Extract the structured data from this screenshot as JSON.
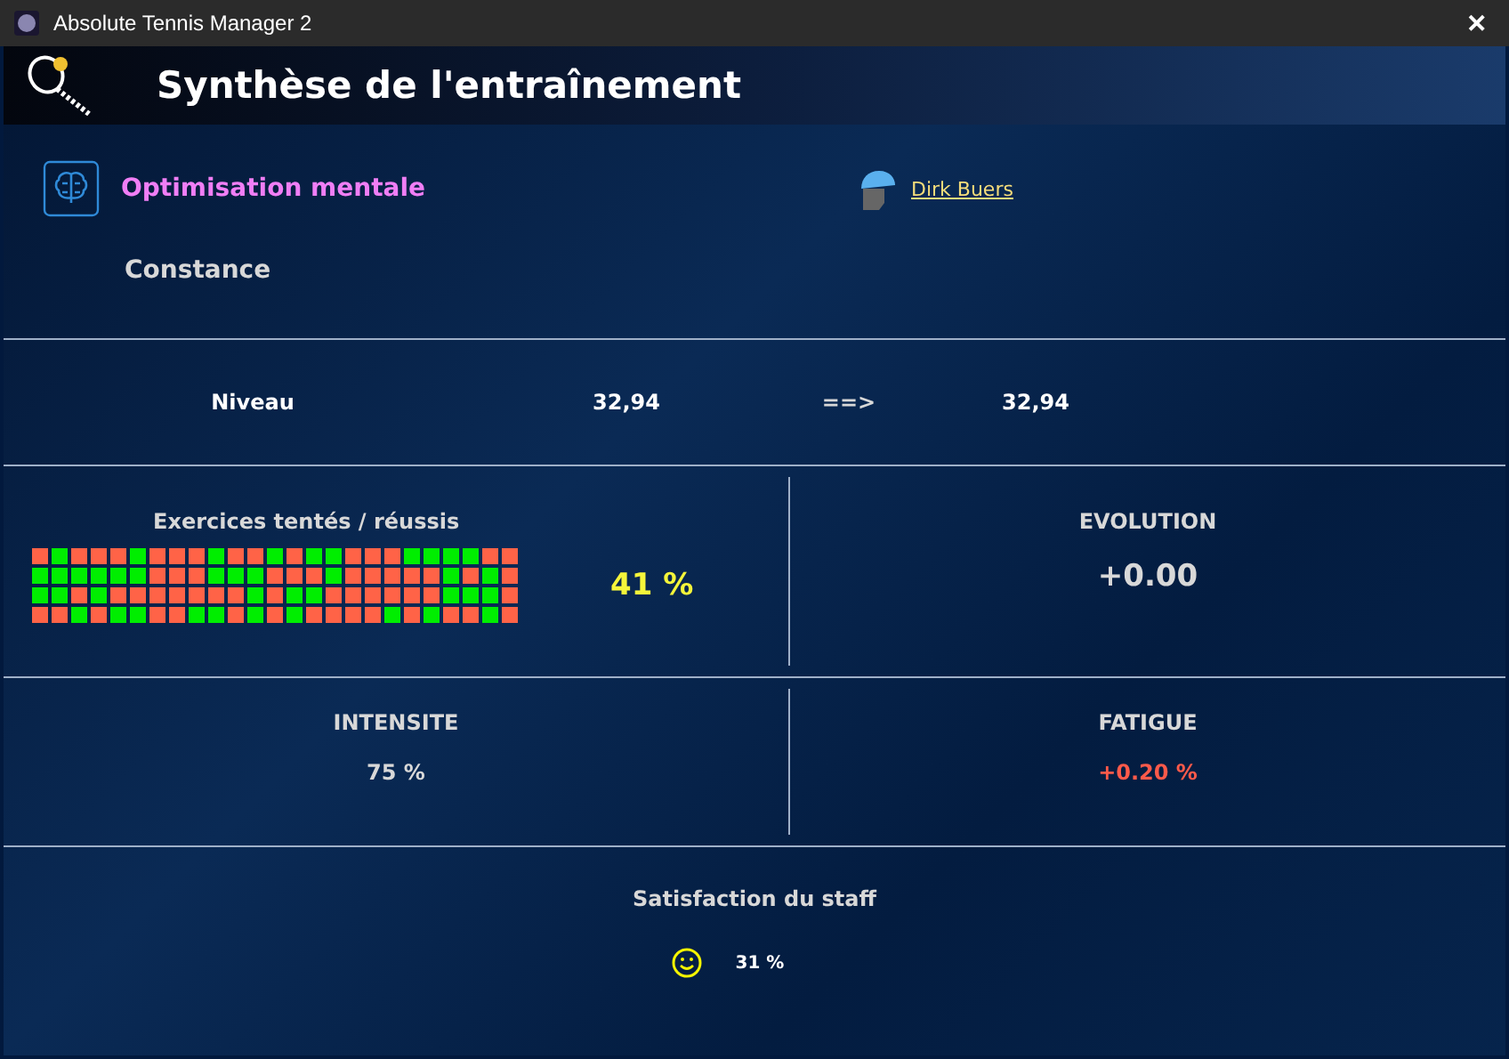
{
  "window": {
    "title": "Absolute Tennis Manager 2",
    "close": "✕"
  },
  "header": {
    "title": "Synthèse de l'entraînement"
  },
  "training": {
    "name": "Optimisation mentale",
    "skill": "Constance",
    "coach": "Dirk Buers"
  },
  "level": {
    "label": "Niveau",
    "before": "32,94",
    "arrow": "==>",
    "after": "32,94"
  },
  "exercises": {
    "label": "Exercices tentés / réussis",
    "rate": "41 %",
    "grid": [
      [
        false,
        true,
        false,
        false,
        false,
        true,
        false,
        false,
        false,
        true,
        false,
        false,
        true,
        false,
        true,
        true,
        false,
        false,
        false,
        true,
        true,
        true,
        true,
        false,
        false
      ],
      [
        true,
        true,
        true,
        true,
        true,
        true,
        false,
        false,
        false,
        true,
        true,
        true,
        false,
        false,
        false,
        true,
        false,
        false,
        false,
        false,
        false,
        true,
        false,
        true,
        false
      ],
      [
        true,
        true,
        false,
        true,
        false,
        false,
        false,
        false,
        false,
        false,
        false,
        true,
        false,
        true,
        true,
        false,
        false,
        false,
        false,
        false,
        false,
        true,
        true,
        true,
        false
      ],
      [
        false,
        false,
        true,
        false,
        true,
        true,
        false,
        false,
        true,
        true,
        false,
        true,
        false,
        true,
        false,
        false,
        false,
        false,
        true,
        false,
        true,
        false,
        false,
        true,
        false
      ]
    ]
  },
  "evolution": {
    "label": "EVOLUTION",
    "value": "+0.00"
  },
  "intensity": {
    "label": "INTENSITE",
    "value": "75 %"
  },
  "fatigue": {
    "label": "FATIGUE",
    "value": "+0.20 %"
  },
  "staff": {
    "label": "Satisfaction du staff",
    "value": "31 %"
  }
}
